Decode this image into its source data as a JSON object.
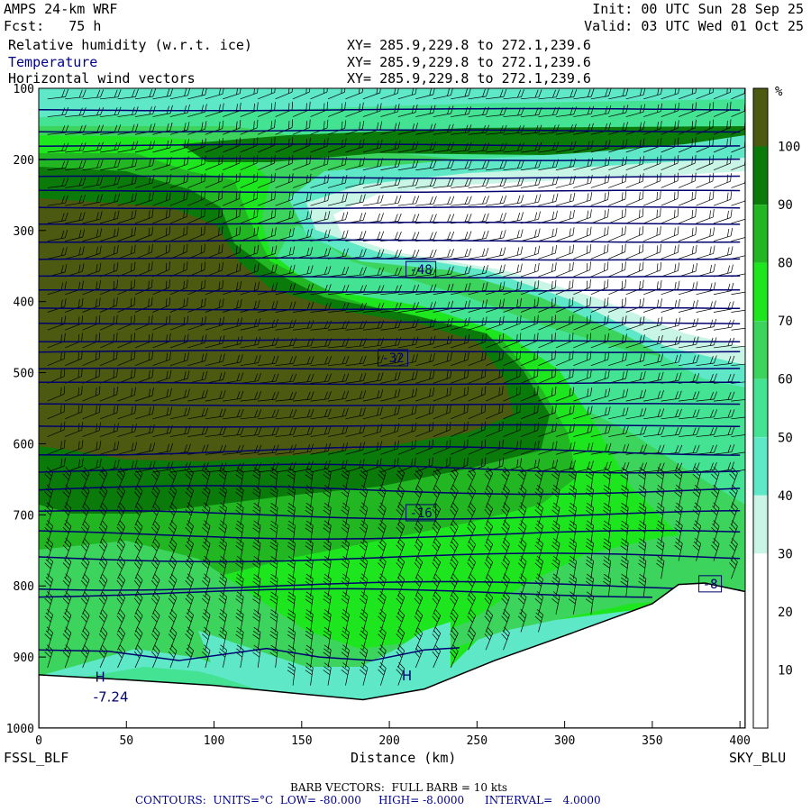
{
  "header": {
    "model": "AMPS 24-km WRF",
    "fcst": "Fcst:   75 h",
    "init": "Init: 00 UTC Sun 28 Sep 25",
    "valid": "Valid: 03 UTC Wed 01 Oct 25",
    "fields": [
      {
        "name": "Relative humidity (w.r.t. ice)",
        "xy": "XY= 285.9,229.8 to 272.1,239.6"
      },
      {
        "name": "Temperature",
        "xy": "XY= 285.9,229.8 to 272.1,239.6"
      },
      {
        "name": "Horizontal wind vectors",
        "xy": "XY= 285.9,229.8 to 272.1,239.6"
      }
    ]
  },
  "footer": {
    "left_station": "FSSL_BLF",
    "right_station": "SKY_BLU",
    "barb_text": "BARB VECTORS:  FULL BARB = 10 kts",
    "contours_text": "CONTOURS:  UNITS=°C  LOW= -80.000     HIGH= -8.0000      INTERVAL=   4.0000"
  },
  "colors": {
    "rh_10_30": "#ffffff",
    "rh_30_40": "#c8f5e6",
    "rh_40_50": "#5ee8c8",
    "rh_50_60": "#44e394",
    "rh_60_70": "#3cd45c",
    "rh_70_80": "#1ee61e",
    "rh_80_90": "#22b622",
    "rh_90_100": "#0a7a0a",
    "rh_100": "#4b5a10",
    "contour": "#00006e",
    "barb": "#000000"
  },
  "chart_data": {
    "type": "cross-section",
    "title": "Relative humidity (w.r.t. ice)",
    "xlabel": "Distance (km)",
    "ylabel": "",
    "xlim": [
      0,
      403
    ],
    "ylim": [
      1000,
      100
    ],
    "x_ticks": [
      0,
      50,
      100,
      150,
      200,
      250,
      300,
      350,
      400
    ],
    "y_ticks": [
      100,
      200,
      300,
      400,
      500,
      600,
      700,
      800,
      900,
      1000
    ],
    "colorbar": {
      "unit": "%",
      "levels": [
        10,
        20,
        30,
        40,
        50,
        60,
        70,
        80,
        90,
        100
      ]
    },
    "terrain_surface": [
      [
        0,
        925
      ],
      [
        50,
        932
      ],
      [
        100,
        940
      ],
      [
        150,
        952
      ],
      [
        185,
        960
      ],
      [
        220,
        945
      ],
      [
        260,
        905
      ],
      [
        300,
        870
      ],
      [
        350,
        825
      ],
      [
        365,
        798
      ],
      [
        380,
        796
      ],
      [
        403,
        808
      ]
    ],
    "temperature_contours": [
      {
        "label": "-48",
        "level": -48,
        "points": [
          [
            0,
            385
          ],
          [
            403,
            388
          ]
        ],
        "label_at": [
          218,
          355
        ]
      },
      {
        "label": "-32",
        "level": -32,
        "points": [
          [
            0,
            470
          ],
          [
            403,
            480
          ]
        ],
        "label_at": [
          202,
          479
        ]
      },
      {
        "label": "-16",
        "level": -16,
        "points": [
          [
            0,
            728
          ],
          [
            50,
            712
          ],
          [
            100,
            703
          ],
          [
            200,
            695
          ],
          [
            300,
            697
          ],
          [
            403,
            702
          ]
        ],
        "label_at": [
          218,
          697
        ]
      },
      {
        "label": "-8",
        "level": -8,
        "points": [
          [
            0,
            810
          ],
          [
            100,
            800
          ],
          [
            200,
            800
          ],
          [
            300,
            798
          ],
          [
            403,
            800
          ]
        ],
        "label_at": [
          383,
          797
        ]
      }
    ],
    "extrema": [
      {
        "type": "H",
        "value": "-7.24",
        "x": 35,
        "y": 935
      },
      {
        "type": "H",
        "value": "",
        "x": 210,
        "y": 933
      }
    ]
  }
}
